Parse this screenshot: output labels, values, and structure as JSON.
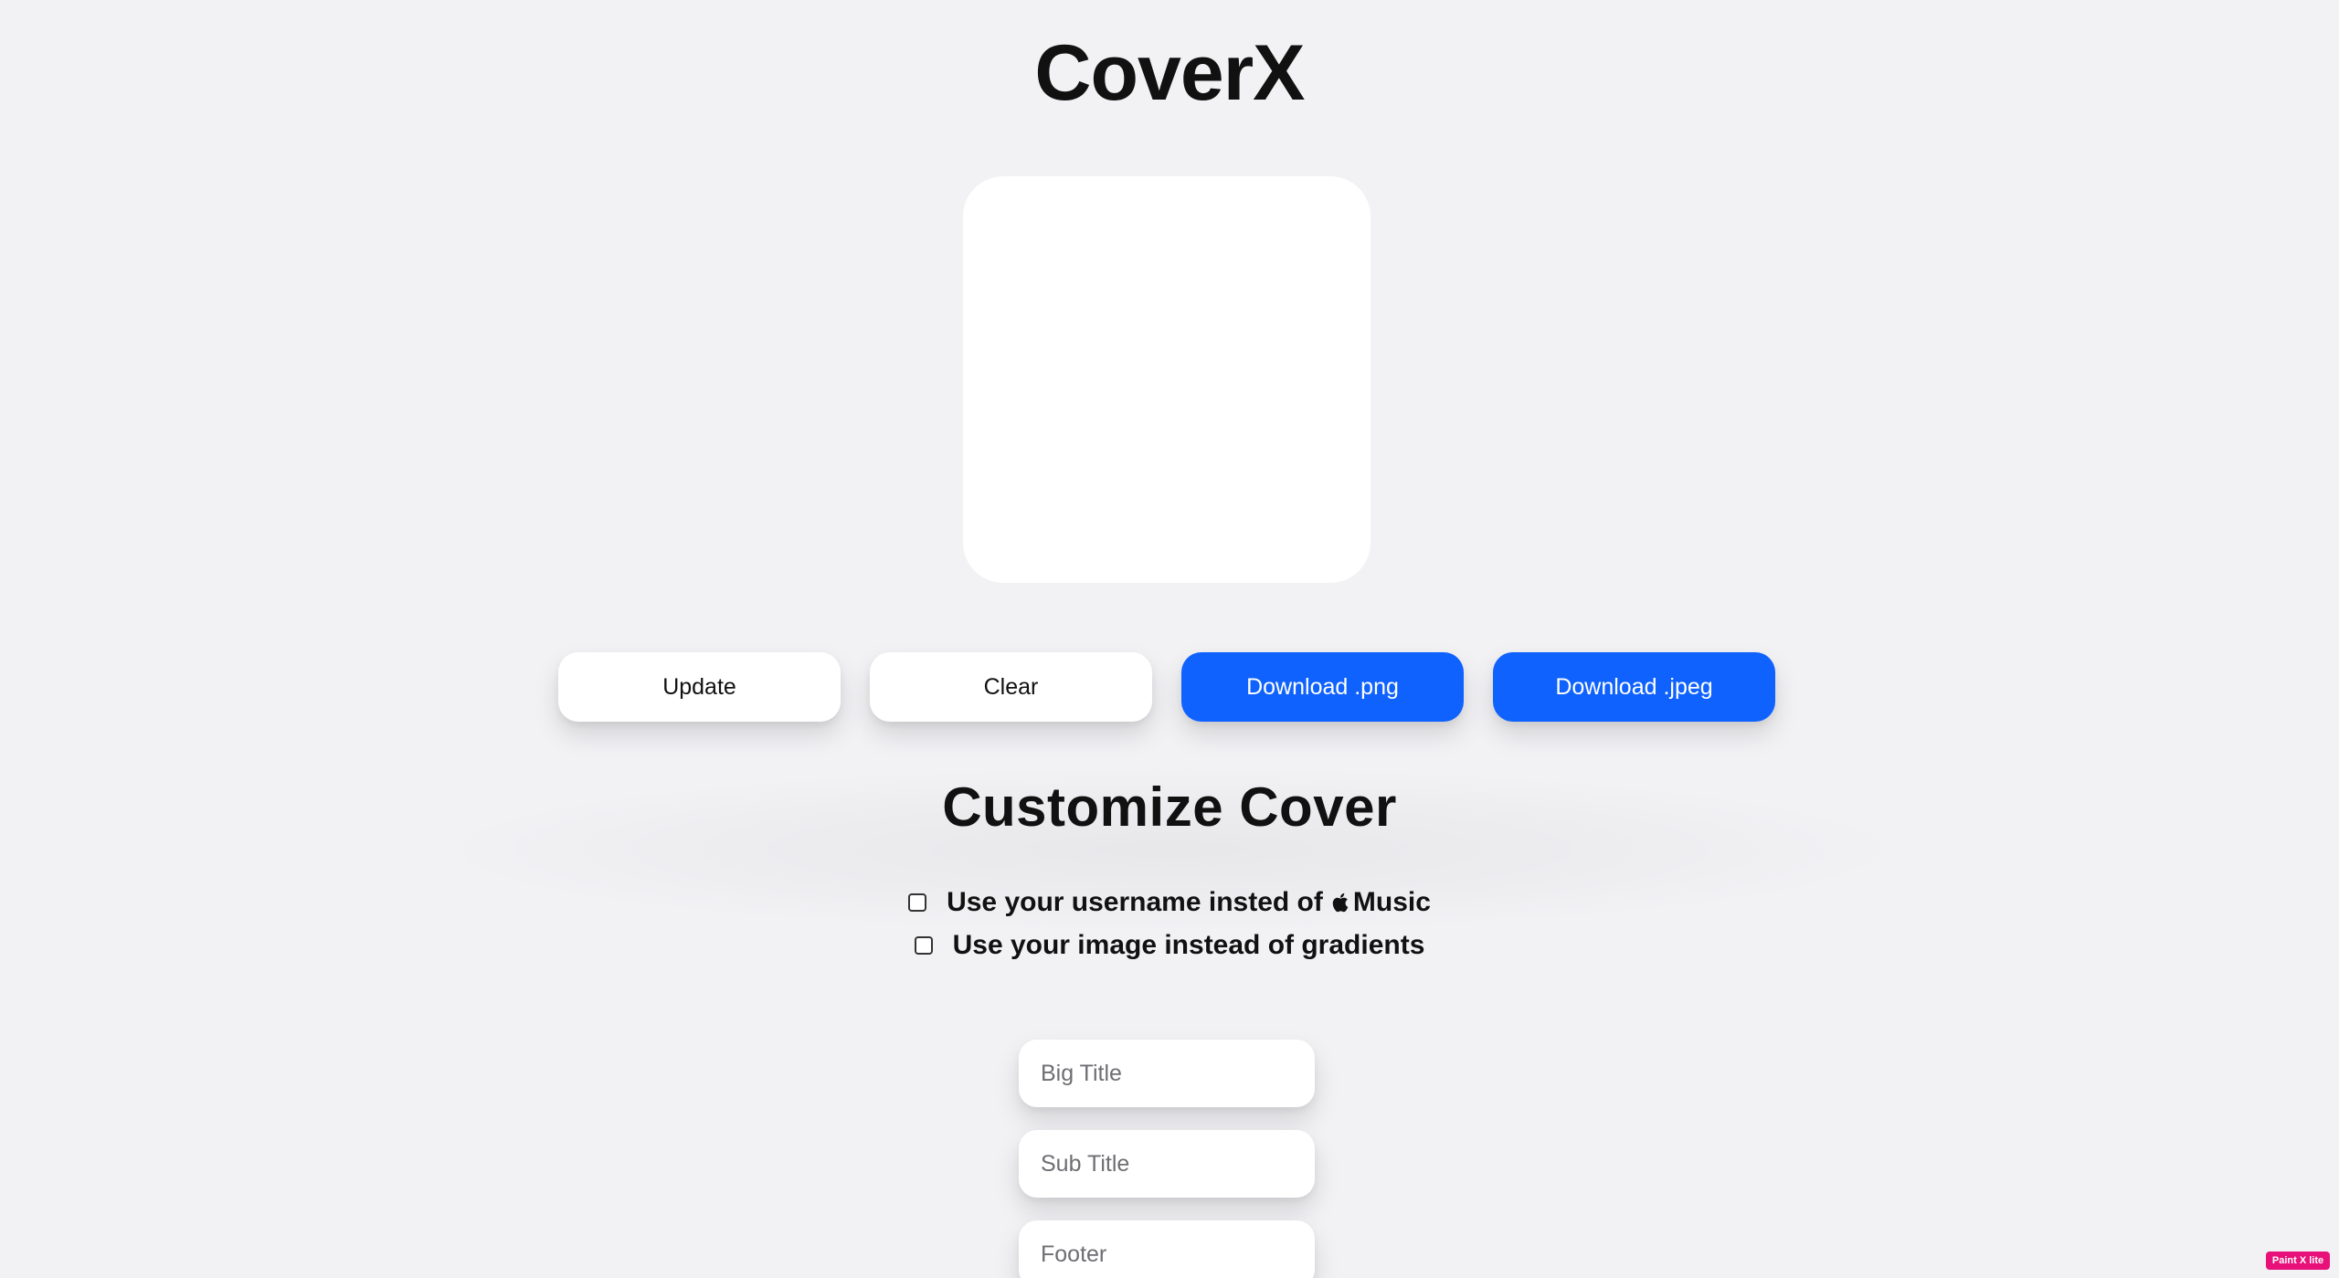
{
  "app": {
    "title": "CoverX"
  },
  "actions": {
    "update_label": "Update",
    "clear_label": "Clear",
    "download_png_label": "Download .png",
    "download_jpeg_label": "Download .jpeg"
  },
  "customize": {
    "title": "Customize Cover",
    "options": [
      {
        "label_before": "Use your username insted of",
        "label_after": "Music",
        "icon": "apple-logo-icon",
        "checked": false
      },
      {
        "label": "Use your image instead of gradients",
        "checked": false
      }
    ],
    "fields": {
      "big_title_placeholder": "Big Title",
      "sub_title_placeholder": "Sub Title",
      "footer_placeholder": "Footer"
    }
  },
  "badge": {
    "label": "Paint X lite"
  },
  "colors": {
    "background": "#f2f2f5",
    "accent": "#0f62fe",
    "badge": "#e8117a"
  }
}
